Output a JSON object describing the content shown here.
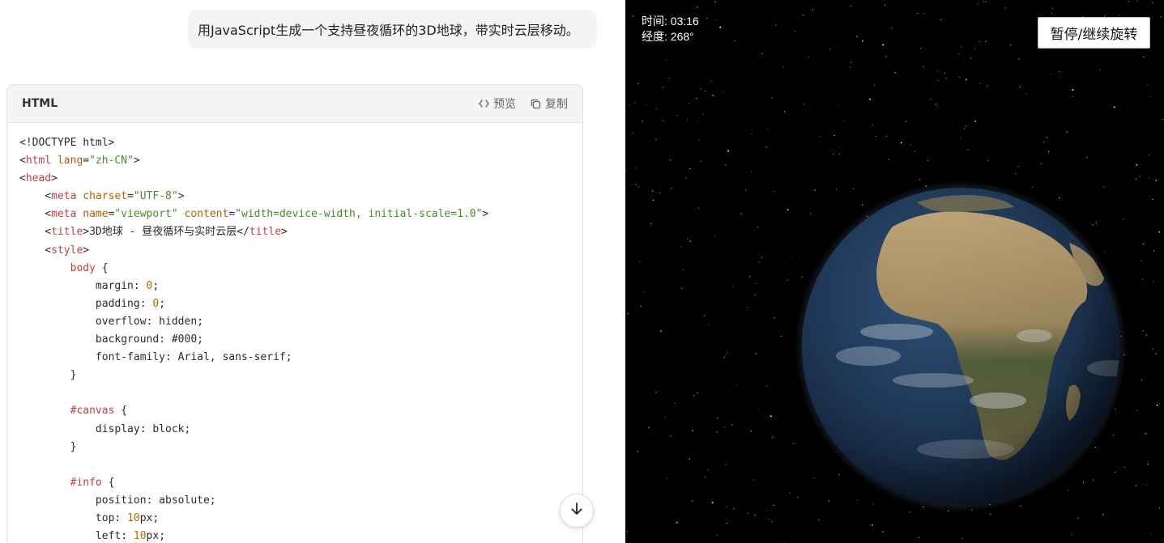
{
  "chat": {
    "user_message": "用JavaScript生成一个支持昼夜循环的3D地球，带实时云层移动。",
    "code_block": {
      "language": "HTML",
      "preview_label": "预览",
      "copy_label": "复制",
      "lines": [
        [
          {
            "t": "<!DOCTYPE html>",
            "c": "punc"
          }
        ],
        [
          {
            "t": "<",
            "c": "punc"
          },
          {
            "t": "html",
            "c": "tag"
          },
          {
            "t": " ",
            "c": "punc"
          },
          {
            "t": "lang",
            "c": "attr"
          },
          {
            "t": "=",
            "c": "punc"
          },
          {
            "t": "\"zh-CN\"",
            "c": "str"
          },
          {
            "t": ">",
            "c": "punc"
          }
        ],
        [
          {
            "t": "<",
            "c": "punc"
          },
          {
            "t": "head",
            "c": "tag"
          },
          {
            "t": ">",
            "c": "punc"
          }
        ],
        [
          {
            "t": "    <",
            "c": "punc"
          },
          {
            "t": "meta",
            "c": "tag"
          },
          {
            "t": " ",
            "c": "punc"
          },
          {
            "t": "charset",
            "c": "attr"
          },
          {
            "t": "=",
            "c": "punc"
          },
          {
            "t": "\"UTF-8\"",
            "c": "str"
          },
          {
            "t": ">",
            "c": "punc"
          }
        ],
        [
          {
            "t": "    <",
            "c": "punc"
          },
          {
            "t": "meta",
            "c": "tag"
          },
          {
            "t": " ",
            "c": "punc"
          },
          {
            "t": "name",
            "c": "attr"
          },
          {
            "t": "=",
            "c": "punc"
          },
          {
            "t": "\"viewport\"",
            "c": "str"
          },
          {
            "t": " ",
            "c": "punc"
          },
          {
            "t": "content",
            "c": "attr"
          },
          {
            "t": "=",
            "c": "punc"
          },
          {
            "t": "\"width=device-width, initial-scale=1.0\"",
            "c": "str"
          },
          {
            "t": ">",
            "c": "punc"
          }
        ],
        [
          {
            "t": "    <",
            "c": "punc"
          },
          {
            "t": "title",
            "c": "tag"
          },
          {
            "t": ">3D地球 - 昼夜循环与实时云层</",
            "c": "punc"
          },
          {
            "t": "title",
            "c": "tag"
          },
          {
            "t": ">",
            "c": "punc"
          }
        ],
        [
          {
            "t": "    <",
            "c": "punc"
          },
          {
            "t": "style",
            "c": "tag"
          },
          {
            "t": ">",
            "c": "punc"
          }
        ],
        [
          {
            "t": "        ",
            "c": "punc"
          },
          {
            "t": "body",
            "c": "sel"
          },
          {
            "t": " {",
            "c": "punc"
          }
        ],
        [
          {
            "t": "            margin: ",
            "c": "punc"
          },
          {
            "t": "0",
            "c": "num"
          },
          {
            "t": ";",
            "c": "punc"
          }
        ],
        [
          {
            "t": "            padding: ",
            "c": "punc"
          },
          {
            "t": "0",
            "c": "num"
          },
          {
            "t": ";",
            "c": "punc"
          }
        ],
        [
          {
            "t": "            overflow: hidden;",
            "c": "punc"
          }
        ],
        [
          {
            "t": "            background: #000;",
            "c": "punc"
          }
        ],
        [
          {
            "t": "            font-family: Arial, sans-serif;",
            "c": "punc"
          }
        ],
        [
          {
            "t": "        }",
            "c": "punc"
          }
        ],
        [
          {
            "t": "",
            "c": "punc"
          }
        ],
        [
          {
            "t": "        ",
            "c": "punc"
          },
          {
            "t": "#canvas",
            "c": "sel"
          },
          {
            "t": " {",
            "c": "punc"
          }
        ],
        [
          {
            "t": "            display: block;",
            "c": "punc"
          }
        ],
        [
          {
            "t": "        }",
            "c": "punc"
          }
        ],
        [
          {
            "t": "",
            "c": "punc"
          }
        ],
        [
          {
            "t": "        ",
            "c": "punc"
          },
          {
            "t": "#info",
            "c": "sel"
          },
          {
            "t": " {",
            "c": "punc"
          }
        ],
        [
          {
            "t": "            position: absolute;",
            "c": "punc"
          }
        ],
        [
          {
            "t": "            top: ",
            "c": "punc"
          },
          {
            "t": "10",
            "c": "num"
          },
          {
            "t": "px;",
            "c": "punc"
          }
        ],
        [
          {
            "t": "            left: ",
            "c": "punc"
          },
          {
            "t": "10",
            "c": "num"
          },
          {
            "t": "px;",
            "c": "punc"
          }
        ]
      ]
    }
  },
  "preview": {
    "time_text": "时间: 03:16",
    "longitude_text": "经度: 268°",
    "toggle_button_label": "暂停/继续旋转",
    "globe_icon": "earth-globe-africa",
    "colors": {
      "space": "#000000",
      "ocean": "#1f3a5c",
      "land": "#b89a6a",
      "vegetation": "#4c5a30",
      "cloud": "#e6e9ee",
      "code_tag": "#c24040",
      "code_string": "#448c27",
      "code_number": "#b06a00"
    }
  },
  "icons": {
    "preview": "code-brackets-icon",
    "copy": "copy-icon",
    "scroll": "arrow-down-icon"
  }
}
